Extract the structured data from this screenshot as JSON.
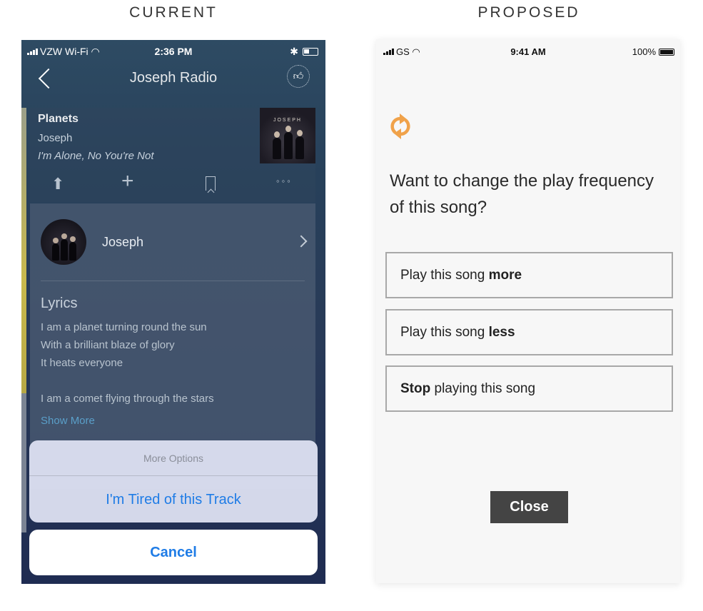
{
  "headings": {
    "current": "CURRENT",
    "proposed": "PROPOSED"
  },
  "current": {
    "status_bar": {
      "carrier": "VZW Wi-Fi",
      "time": "2:36 PM"
    },
    "nav": {
      "title": "Joseph Radio"
    },
    "track": {
      "title": "Planets",
      "artist": "Joseph",
      "album": "I'm Alone, No You're Not",
      "album_art_text": "JOSEPH"
    },
    "artist_row": {
      "name": "Joseph"
    },
    "lyrics": {
      "title": "Lyrics",
      "lines": [
        "I am a planet turning round the sun",
        "With a brilliant blaze of glory",
        "It heats everyone",
        "I am a comet flying through the stars"
      ],
      "show_more": "Show More"
    },
    "action_sheet": {
      "title": "More Options",
      "action": "I'm Tired of this Track",
      "cancel": "Cancel"
    }
  },
  "proposed": {
    "status_bar": {
      "carrier": "GS",
      "time": "9:41 AM",
      "battery": "100%"
    },
    "icon": {
      "name": "refresh-icon",
      "color": "#f0a24a"
    },
    "question": "Want to change the play frequency of this song?",
    "options": [
      {
        "before": "Play this song ",
        "bold": "more",
        "after": ""
      },
      {
        "before": "Play this song ",
        "bold": "less",
        "after": ""
      },
      {
        "before": "",
        "bold": "Stop",
        "after": " playing this song"
      }
    ],
    "close": "Close"
  }
}
